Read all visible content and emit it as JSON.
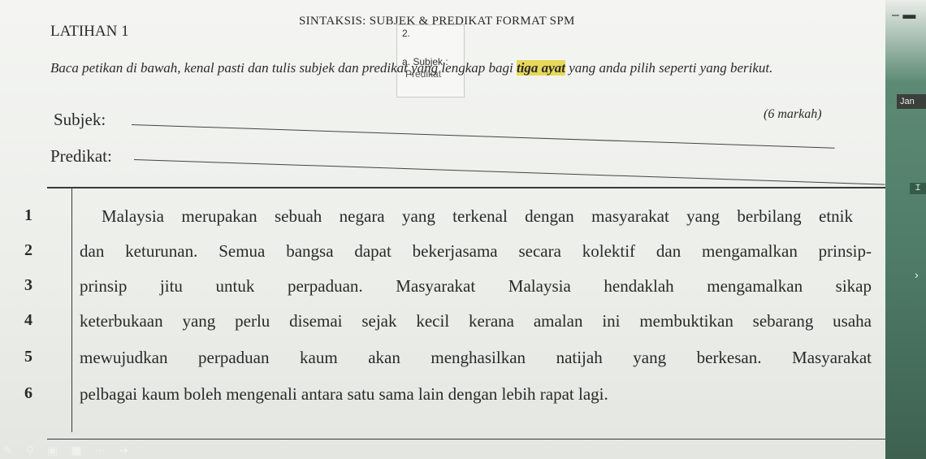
{
  "header": {
    "title": "SINTAKSIS: SUBJEK & PREDIKAT FORMAT SPM"
  },
  "exercise": {
    "title": "LATIHAN 1",
    "instruction_before": "Baca petikan di bawah, kenal pasti dan tulis subjek dan predikat yang lengkap bagi ",
    "instruction_highlight": "tiga ayat",
    "instruction_after": " yang anda pilih seperti yang berikut.",
    "marks": "(6 markah)",
    "subject_label": "Subjek:",
    "predicate_label": "Predikat:"
  },
  "note": {
    "number": "2.",
    "line1": "a. Subjek :",
    "line2": "Predikat"
  },
  "passage": [
    {
      "num": "1",
      "text": "Malaysia merupakan sebuah negara yang terkenal dengan masyarakat yang berbilang etnik"
    },
    {
      "num": "2",
      "text": "dan keturunan. Semua bangsa dapat bekerjasama secara kolektif dan mengamalkan prinsip-"
    },
    {
      "num": "3",
      "text": "prinsip jitu untuk perpaduan. Masyarakat Malaysia hendaklah mengamalkan sikap"
    },
    {
      "num": "4",
      "text": "keterbukaan yang perlu disemai sejak kecil kerana amalan ini membuktikan sebarang usaha"
    },
    {
      "num": "5",
      "text": "mewujudkan perpaduan kaum akan menghasilkan natijah yang berkesan. Masyarakat"
    },
    {
      "num": "6",
      "text": "pelbagai kaum boleh mengenali antara satu sama lain dengan lebih rapat lagi."
    }
  ],
  "side": {
    "badge": "Jan",
    "badge2": "Ɪ"
  },
  "toolbar": {
    "items": [
      "pen-icon",
      "search-icon",
      "cc-icon",
      "camera-icon",
      "more-icon",
      "next-icon"
    ]
  }
}
